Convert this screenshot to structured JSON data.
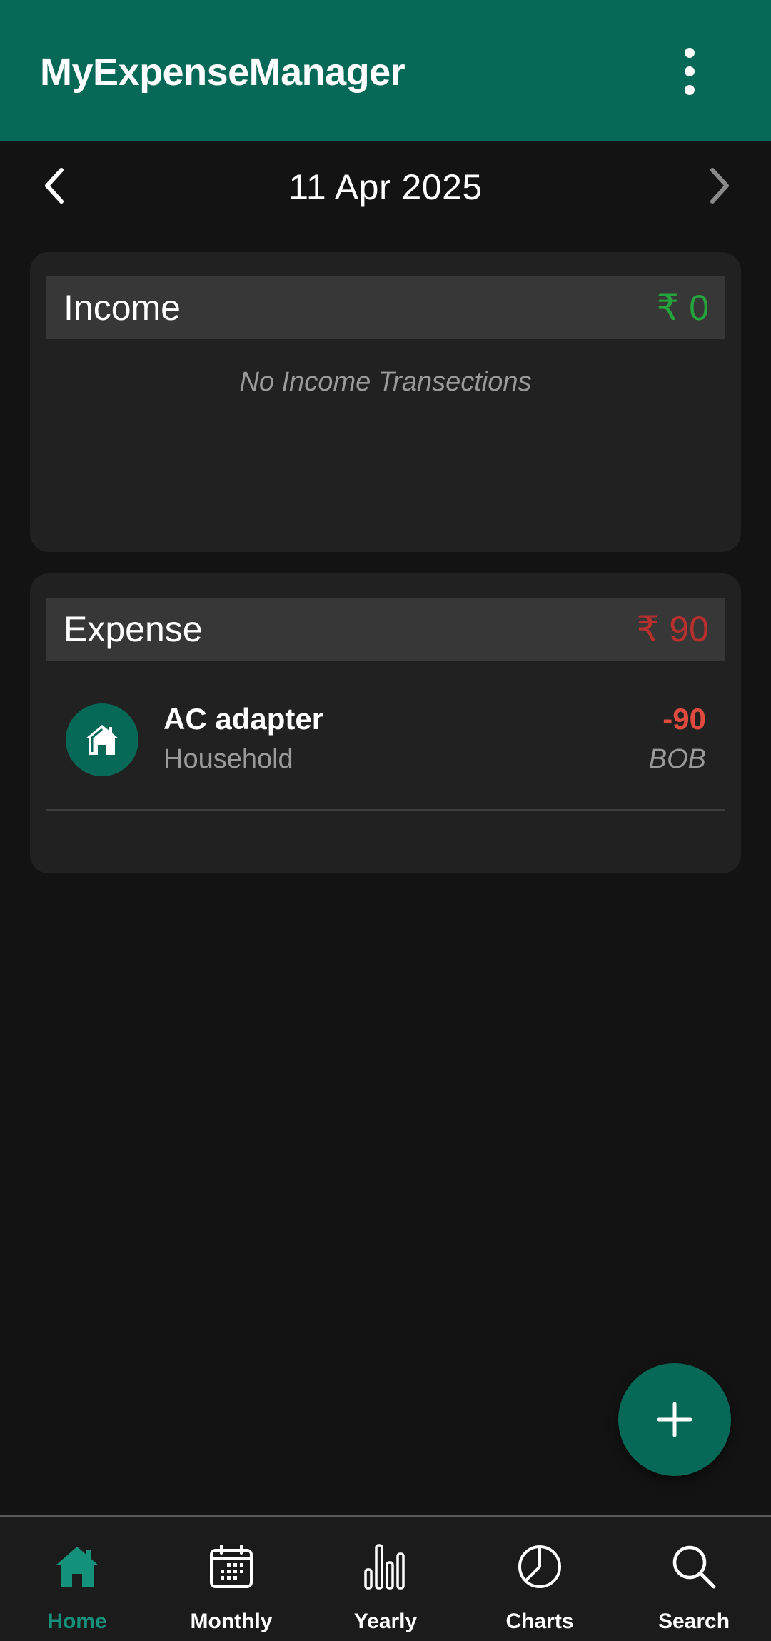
{
  "app": {
    "title": "MyExpenseManager",
    "menu_icon": "more-vert-icon",
    "accent_color": "#066856"
  },
  "date_nav": {
    "date": "11 Apr 2025",
    "prev_icon": "chevron-left-icon",
    "next_icon": "chevron-right-icon"
  },
  "income": {
    "title": "Income",
    "amount": "₹ 0",
    "amount_color": "#25a43c",
    "empty_message": "No Income Transections"
  },
  "expense": {
    "title": "Expense",
    "amount": "₹ 90",
    "amount_color": "#b8302e",
    "transactions": [
      {
        "title": "AC adapter",
        "category": "Household",
        "amount": "-90",
        "account": "BOB",
        "icon": "house-icon"
      }
    ]
  },
  "fab": {
    "icon": "plus-icon"
  },
  "bottom_nav": {
    "items": [
      {
        "label": "Home",
        "icon": "home-icon",
        "active": true
      },
      {
        "label": "Monthly",
        "icon": "calendar-icon",
        "active": false
      },
      {
        "label": "Yearly",
        "icon": "bar-chart-icon",
        "active": false
      },
      {
        "label": "Charts",
        "icon": "pie-chart-icon",
        "active": false
      },
      {
        "label": "Search",
        "icon": "search-icon",
        "active": false
      }
    ],
    "active_color": "#13917a"
  }
}
